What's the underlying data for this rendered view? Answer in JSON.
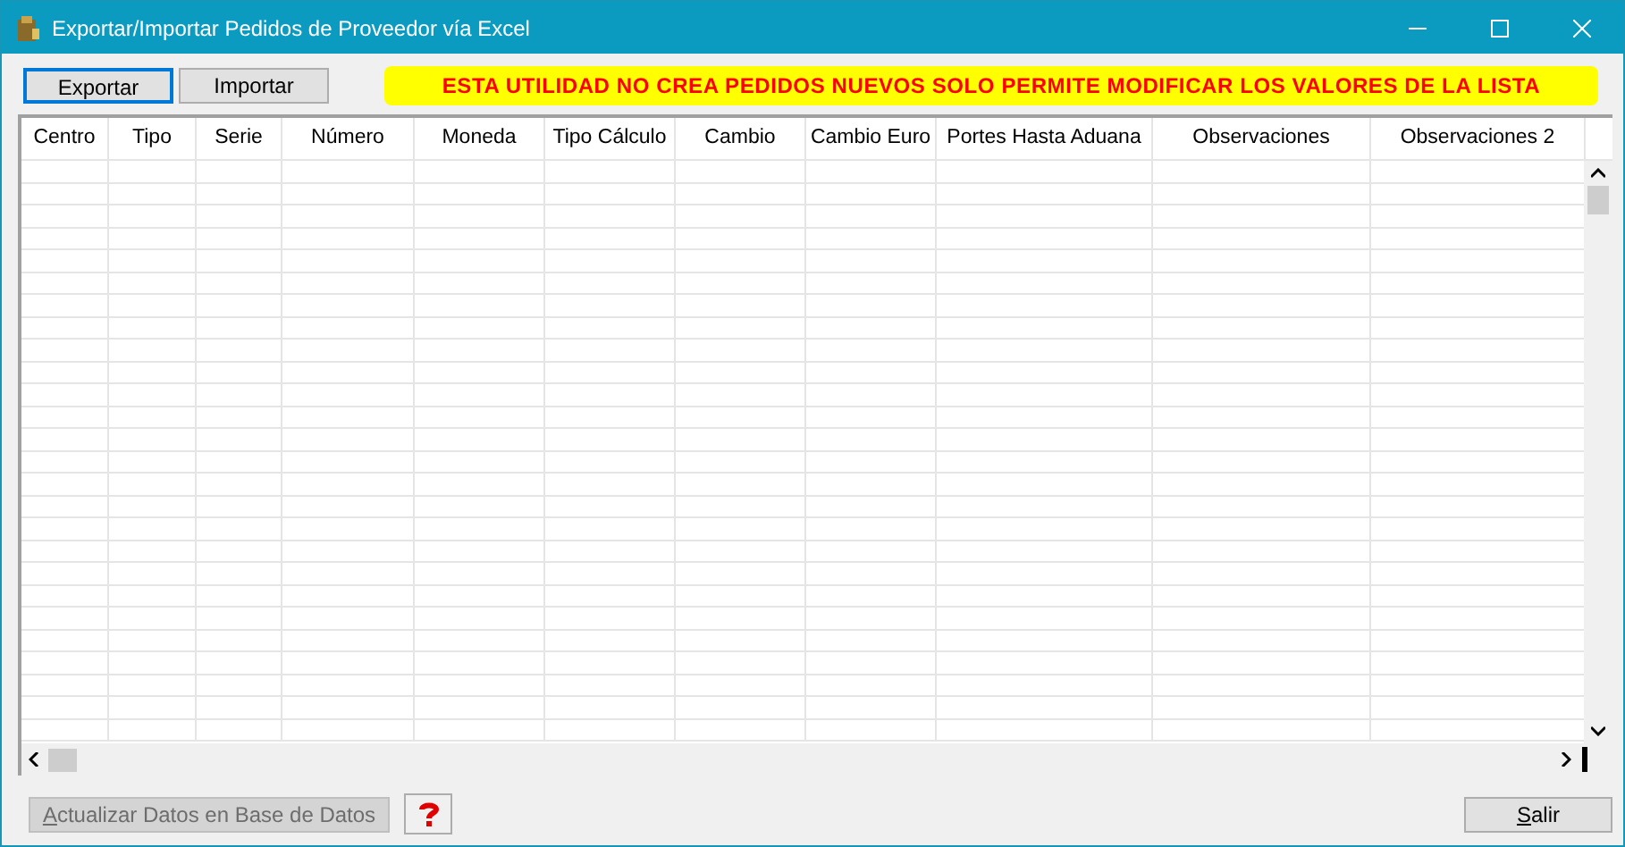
{
  "window": {
    "title": "Exportar/Importar Pedidos de Proveedor vía Excel"
  },
  "toolbar": {
    "buttons": [
      {
        "label": "Exportar",
        "focused": true
      },
      {
        "label": "Importar",
        "focused": false
      }
    ],
    "notice": "ESTA UTILIDAD NO CREA PEDIDOS NUEVOS SOLO PERMITE MODIFICAR LOS VALORES DE LA LISTA"
  },
  "table": {
    "columns": [
      "Centro",
      "Tipo",
      "Serie",
      "Número",
      "Moneda",
      "Tipo Cálculo",
      "Cambio",
      "Cambio Euro",
      "Portes Hasta Aduana",
      "Observaciones",
      "Observaciones 2"
    ]
  },
  "footer": {
    "update_button": {
      "label": "Actualizar Datos en Base de Datos",
      "disabled": true
    },
    "exit_button": {
      "label": "Salir",
      "disabled": false
    }
  }
}
